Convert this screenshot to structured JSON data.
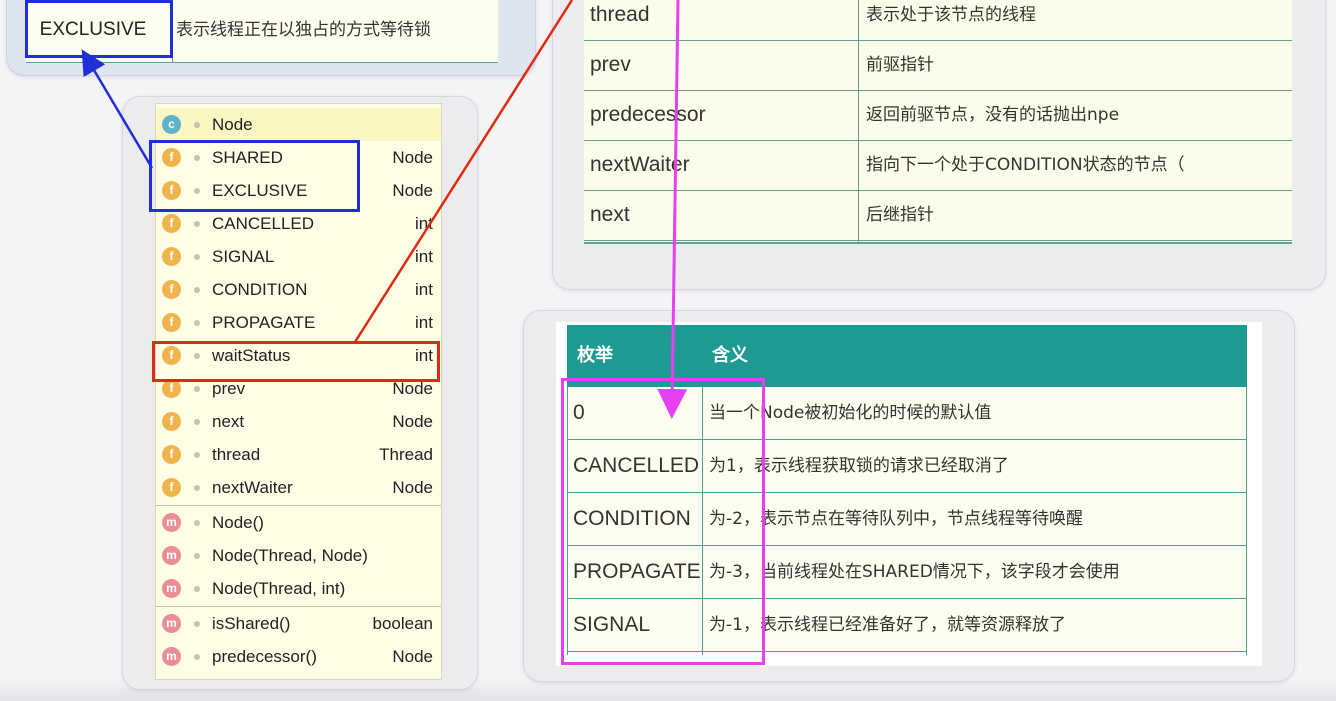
{
  "top_left_snippet": {
    "key": "EXCLUSIVE",
    "description": "表示线程正在以独占的方式等待锁"
  },
  "structure": {
    "header": {
      "icon": "class-c-icon",
      "name": "Node"
    },
    "fields": [
      {
        "name": "SHARED",
        "type": "Node",
        "icon": "static-final-field-icon"
      },
      {
        "name": "EXCLUSIVE",
        "type": "Node",
        "icon": "static-final-field-icon"
      },
      {
        "name": "CANCELLED",
        "type": "int",
        "icon": "static-final-field-icon"
      },
      {
        "name": "SIGNAL",
        "type": "int",
        "icon": "static-final-field-icon"
      },
      {
        "name": "CONDITION",
        "type": "int",
        "icon": "static-final-field-icon"
      },
      {
        "name": "PROPAGATE",
        "type": "int",
        "icon": "static-final-field-icon"
      },
      {
        "name": "waitStatus",
        "type": "int",
        "icon": "field-icon"
      },
      {
        "name": "prev",
        "type": "Node",
        "icon": "field-icon"
      },
      {
        "name": "next",
        "type": "Node",
        "icon": "field-icon"
      },
      {
        "name": "thread",
        "type": "Thread",
        "icon": "field-icon"
      },
      {
        "name": "nextWaiter",
        "type": "Node",
        "icon": "field-icon"
      }
    ],
    "constructors": [
      {
        "name": "Node()",
        "type": ""
      },
      {
        "name": "Node(Thread, Node)",
        "type": ""
      },
      {
        "name": "Node(Thread, int)",
        "type": ""
      }
    ],
    "methods": [
      {
        "name": "isShared()",
        "type": "boolean"
      },
      {
        "name": "predecessor()",
        "type": "Node"
      }
    ],
    "icon_letters": {
      "class": "c",
      "field": "f",
      "method": "m"
    }
  },
  "field_table": {
    "rows": [
      {
        "key": "thread",
        "value": "表示处于该节点的线程"
      },
      {
        "key": "prev",
        "value": "前驱指针"
      },
      {
        "key": "predecessor",
        "value": "返回前驱节点，没有的话抛出npe"
      },
      {
        "key": "nextWaiter",
        "value": "指向下一个处于CONDITION状态的节点（"
      },
      {
        "key": "next",
        "value": "后继指针"
      }
    ]
  },
  "enum_table": {
    "headers": [
      "枚举",
      "含义"
    ],
    "rows": [
      {
        "key": "0",
        "value": "当一个Node被初始化的时候的默认值"
      },
      {
        "key": "CANCELLED",
        "value": "为1，表示线程获取锁的请求已经取消了"
      },
      {
        "key": "CONDITION",
        "value": "为-2，表示节点在等待队列中，节点线程等待唤醒"
      },
      {
        "key": "PROPAGATE",
        "value": "为-3，当前线程处在SHARED情况下，该字段才会使用"
      },
      {
        "key": "SIGNAL",
        "value": "为-1，表示线程已经准备好了，就等资源释放了"
      }
    ]
  },
  "colors": {
    "annotation_blue": "#1f2fd6",
    "annotation_red": "#e02a12",
    "annotation_magenta": "#e83ff0",
    "table_header_teal": "#1e9a92",
    "table_border": "#46a393",
    "cell_bg": "#fdfdf0"
  }
}
